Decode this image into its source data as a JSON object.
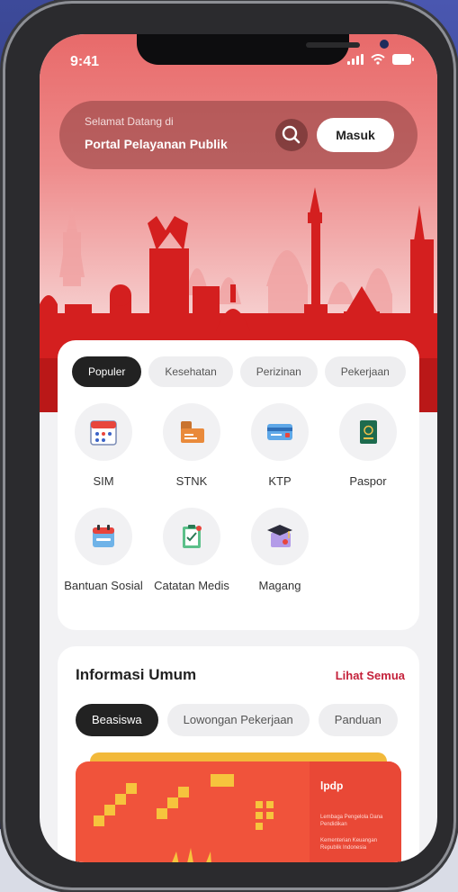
{
  "status_bar": {
    "time": "9:41"
  },
  "header": {
    "greeting": "Selamat Datang di",
    "portal_name": "Portal Pelayanan Publik",
    "login_label": "Masuk"
  },
  "categories": {
    "tabs": [
      {
        "label": "Populer",
        "active": true
      },
      {
        "label": "Kesehatan",
        "active": false
      },
      {
        "label": "Perizinan",
        "active": false
      },
      {
        "label": "Pekerjaan",
        "active": false
      }
    ]
  },
  "services": [
    {
      "label": "SIM",
      "icon": "calendar-icon"
    },
    {
      "label": "STNK",
      "icon": "vehicle-doc-icon"
    },
    {
      "label": "KTP",
      "icon": "id-card-icon"
    },
    {
      "label": "Paspor",
      "icon": "passport-icon"
    },
    {
      "label": "Bantuan Sosial",
      "icon": "aid-calendar-icon"
    },
    {
      "label": "Catatan Medis",
      "icon": "medical-clipboard-icon"
    },
    {
      "label": "Magang",
      "icon": "graduation-cap-icon"
    }
  ],
  "info": {
    "title": "Informasi Umum",
    "see_all": "Lihat Semua",
    "tabs": [
      {
        "label": "Beasiswa",
        "active": true
      },
      {
        "label": "Lowongan Pekerjaan",
        "active": false
      },
      {
        "label": "Panduan",
        "active": false
      }
    ],
    "banner": {
      "logo_text": "lpdp",
      "line1": "Lembaga Pengelola Dana Pendidikan",
      "line2": "Kementerian Keuangan Republik Indonesia"
    }
  },
  "colors": {
    "accent": "#c4213a",
    "hero_top": "#e86a6a",
    "skyline": "#d41f1f",
    "banner": "#f0533b",
    "dark_pill": "#222222"
  }
}
